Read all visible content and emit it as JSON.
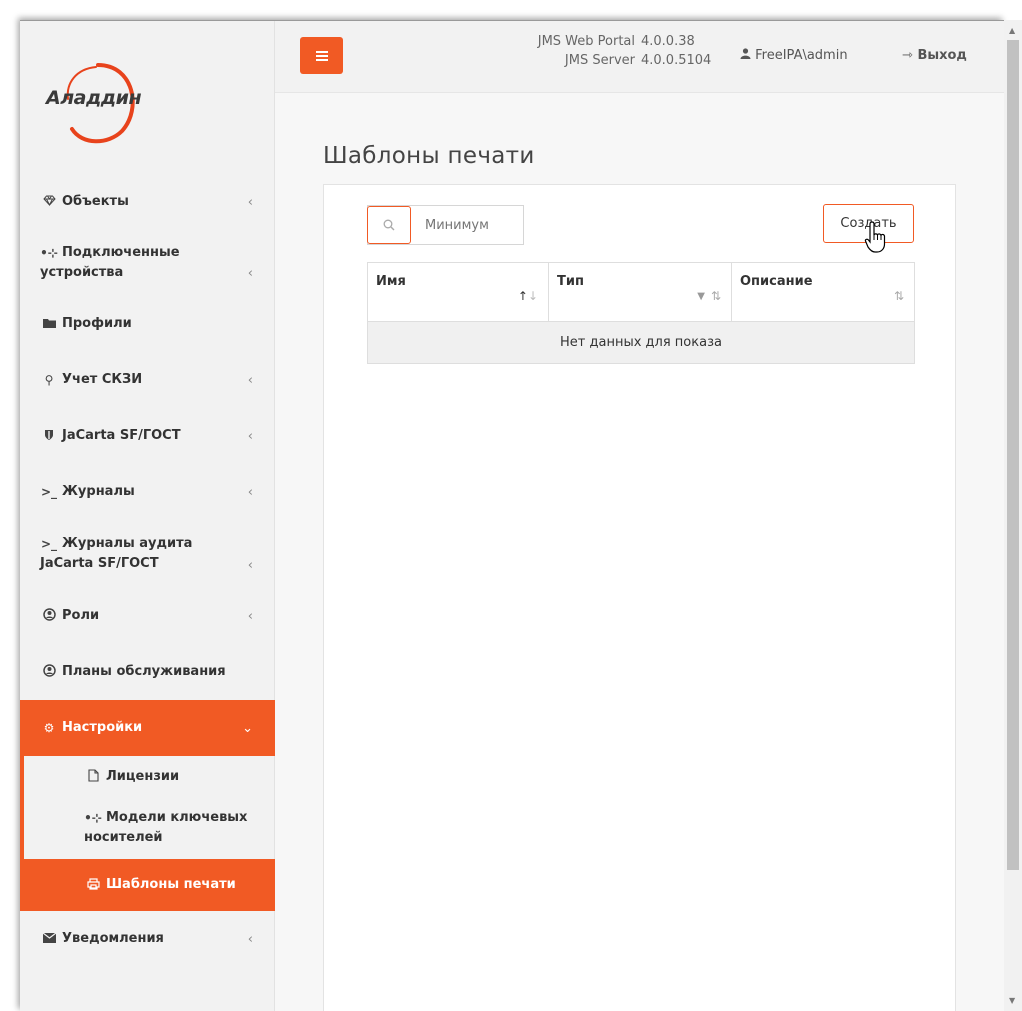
{
  "brand": {
    "logo_text": "Аладдин",
    "accent_color": "#f15a24"
  },
  "header": {
    "menu_icon": "hamburger-icon",
    "versions": {
      "portal_label": "JMS Web Portal",
      "portal_version": "4.0.0.38",
      "server_label": "JMS Server",
      "server_version": "4.0.0.5104"
    },
    "user_name": "FreeIPA\\admin",
    "logout_label": "Выход"
  },
  "sidebar": {
    "items": [
      {
        "label": "Объекты",
        "icon": "diamond-icon",
        "has_children": true
      },
      {
        "label": "Подключенные устройства",
        "line1": "Подключенные",
        "line2": "устройства",
        "icon": "usb-icon",
        "has_children": true
      },
      {
        "label": "Профили",
        "icon": "folder-icon",
        "has_children": false
      },
      {
        "label": "Учет СКЗИ",
        "icon": "key-icon",
        "has_children": true
      },
      {
        "label": "JaCarta SF/ГОСТ",
        "icon": "shield-icon",
        "has_children": true
      },
      {
        "label": "Журналы",
        "icon": "terminal-icon",
        "has_children": true
      },
      {
        "label": "Журналы аудита JaCarta SF/ГОСТ",
        "line1": "Журналы аудита",
        "line2": "JaCarta SF/ГОСТ",
        "icon": "terminal-icon",
        "has_children": true
      },
      {
        "label": "Роли",
        "icon": "user-circle-icon",
        "has_children": true
      },
      {
        "label": "Планы обслуживания",
        "icon": "user-circle-icon",
        "has_children": false
      },
      {
        "label": "Настройки",
        "icon": "gears-icon",
        "has_children": true,
        "expanded": true
      },
      {
        "label": "Уведомления",
        "icon": "envelope-icon",
        "has_children": true
      }
    ],
    "settings_children": [
      {
        "label": "Лицензии",
        "icon": "file-icon"
      },
      {
        "label": "Модели ключевых носителей",
        "line1": "Модели ключевых",
        "line2": "носителей",
        "icon": "usb-icon"
      },
      {
        "label": "Шаблоны печати",
        "icon": "printer-icon",
        "active": true
      }
    ]
  },
  "main": {
    "page_title": "Шаблоны печати",
    "search": {
      "placeholder": "Минимум",
      "value": ""
    },
    "create_label": "Создать",
    "table": {
      "columns": [
        {
          "label": "Имя",
          "sort": "asc"
        },
        {
          "label": "Тип",
          "sort": "none",
          "filter": true
        },
        {
          "label": "Описание",
          "sort": "none"
        }
      ],
      "rows": [],
      "empty_text": "Нет данных для показа"
    }
  }
}
